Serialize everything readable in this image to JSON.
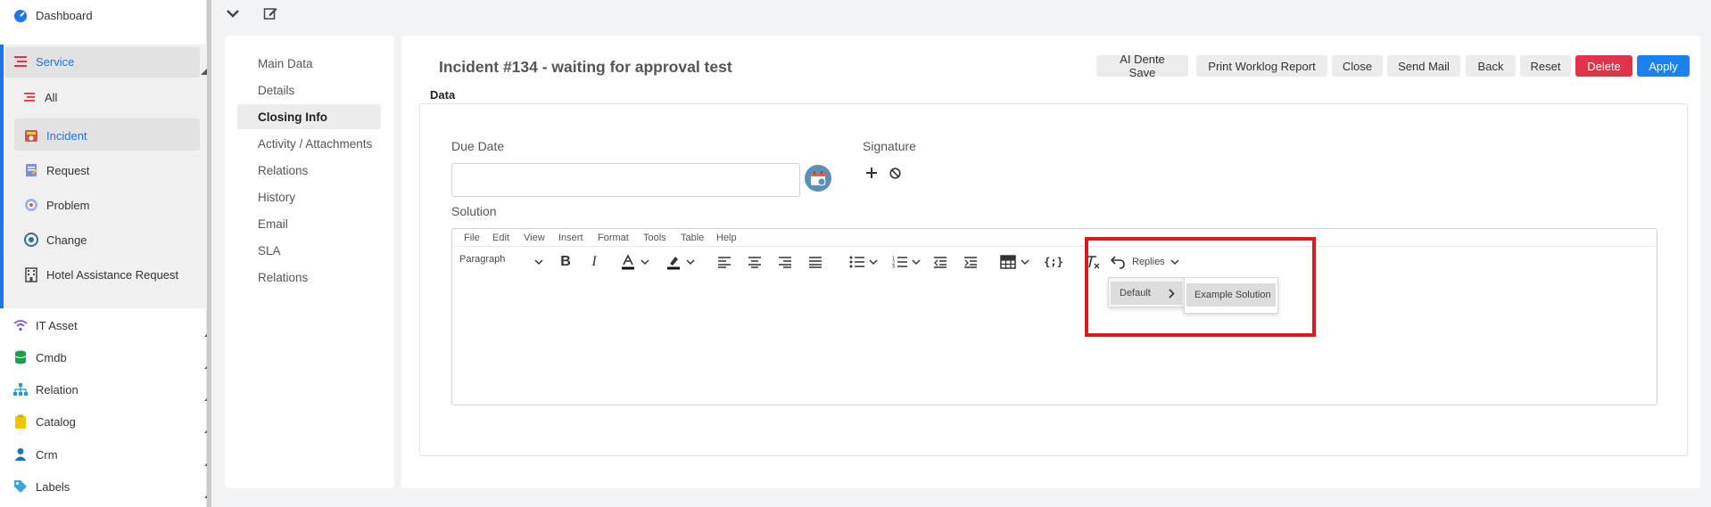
{
  "sidebar": {
    "dashboard": "Dashboard",
    "service": "Service",
    "service_items": [
      "All",
      "Incident",
      "Request",
      "Problem",
      "Change",
      "Hotel Assistance Request"
    ],
    "other_items": [
      "IT Asset",
      "Cmdb",
      "Relation",
      "Catalog",
      "Crm",
      "Labels"
    ],
    "accent_color": "#1e74e8"
  },
  "nav": {
    "items": [
      "Main Data",
      "Details",
      "Closing Info",
      "Activity / Attachments",
      "Relations",
      "History",
      "Email",
      "SLA",
      "Relations"
    ],
    "active": "Closing Info"
  },
  "main": {
    "title": "Incident #134 - waiting for approval test",
    "buttons": {
      "ai_save": "AI Dente Save",
      "print": "Print Worklog Report",
      "close": "Close",
      "send_mail": "Send Mail",
      "back": "Back",
      "reset": "Reset",
      "delete": "Delete",
      "apply": "Apply"
    },
    "section": "Data",
    "due_date_label": "Due Date",
    "due_date_value": "",
    "signature_label": "Signature",
    "solution_label": "Solution"
  },
  "editor": {
    "menu": [
      "File",
      "Edit",
      "View",
      "Insert",
      "Format",
      "Tools",
      "Table",
      "Help"
    ],
    "paragraph": "Paragraph",
    "replies": "Replies",
    "submenu_default": "Default",
    "submenu_example": "Example Solution"
  },
  "colors": {
    "delete": "#e0344a",
    "apply": "#1a82f0",
    "highlight": "#e0181e"
  }
}
